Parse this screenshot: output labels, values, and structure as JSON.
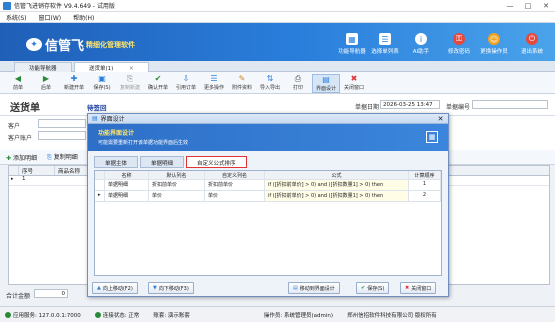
{
  "window": {
    "title": "信管飞进销存软件 V9.4.649 - 试用版",
    "min": "—",
    "max": "□",
    "close": "✕"
  },
  "menu": [
    "系统(S)",
    "窗口(W)",
    "帮助(H)"
  ],
  "banner": {
    "brand": "信管飞",
    "slogan": "精细化管理软件",
    "buttons": [
      {
        "label": "功能导航器",
        "icon": "navigator-icon",
        "color": "#ffffff"
      },
      {
        "label": "选择单列表",
        "icon": "list-icon",
        "color": "#ffffff"
      },
      {
        "label": "AI助手",
        "icon": "assistant-icon",
        "color": "#ffffff"
      },
      {
        "label": "修改密码",
        "icon": "key-icon",
        "color": "#e5483c"
      },
      {
        "label": "更换操作员",
        "icon": "users-icon",
        "color": "#f3a21e"
      },
      {
        "label": "退出系统",
        "icon": "power-icon",
        "color": "#e5483c"
      }
    ]
  },
  "page_tabs": [
    "功能导航器",
    "送货单(1)"
  ],
  "page_tab_close": "✕",
  "toolbar": [
    {
      "label": "前单",
      "glyph": "◀",
      "enabled": true
    },
    {
      "label": "后单",
      "glyph": "▶",
      "enabled": true
    },
    {
      "label": "新建开单",
      "glyph": "✚",
      "enabled": true
    },
    {
      "label": "保存(S)",
      "glyph": "▣",
      "enabled": true
    },
    {
      "label": "复制新建",
      "glyph": "⎘",
      "enabled": false
    },
    {
      "label": "确认开单",
      "glyph": "✔",
      "enabled": true
    },
    {
      "label": "引用订单",
      "glyph": "⇩",
      "enabled": true
    },
    {
      "label": "更多操作",
      "glyph": "☰",
      "enabled": true
    },
    {
      "label": "附件资料",
      "glyph": "✎",
      "enabled": true
    },
    {
      "label": "导入导出",
      "glyph": "⇅",
      "enabled": true
    },
    {
      "label": "打印",
      "glyph": "⎙",
      "enabled": true
    },
    {
      "label": "界面设计",
      "glyph": "▤",
      "enabled": true
    },
    {
      "label": "关闭窗口",
      "glyph": "✖",
      "enabled": true
    }
  ],
  "form": {
    "title": "送货单",
    "status": "待签回",
    "date_label": "单据日期",
    "date_value": "2026-03-25 13:47",
    "number_label": "单据编号",
    "customer_label": "客户",
    "customer_account_label": "客户账户",
    "add_row_label": "添加明细",
    "copy_row_label": "复制明细",
    "grid_cols": [
      "序号",
      "商品名称"
    ],
    "first_row_index": "1",
    "total_label": "合计金额",
    "total_value": "0"
  },
  "statusbar": {
    "app_label": "应用服务: 127.0.0.1:7000",
    "conn_label": "连接状态: 正常",
    "account_label": "账套: 演示账套",
    "operator_label": "操作员: 系统管理员(admin)",
    "company_label": "郑州信招软件科技有限公司 版权所有"
  },
  "dialog": {
    "title": "界面设计",
    "header_title": "功能界面设计",
    "header_sub": "可能需要重新打开该单据功能界面后生效",
    "tabs": [
      "单据主体",
      "单据明细",
      "自定义公式排序"
    ],
    "active_tab": 2,
    "columns": [
      "名称",
      "默认列名",
      "自定义列名",
      "公式",
      "计算顺序"
    ],
    "rows": [
      {
        "name": "单据明细",
        "default": "折扣前单价",
        "custom": "折扣前单价",
        "formula": "if ([折扣前单价] > 0) and ([折扣数量1] > 0) then",
        "order": "1"
      },
      {
        "name": "单据明细",
        "default": "单价",
        "custom": "单价",
        "formula": "if ([折扣前单价] > 0) and ([折扣数量1] > 0) then",
        "order": "2"
      }
    ],
    "buttons": {
      "up": "向上移动(F2)",
      "down": "向下移动(F3)",
      "move": "移动到界面设计",
      "save": "保存(S)",
      "close": "关闭窗口"
    }
  }
}
